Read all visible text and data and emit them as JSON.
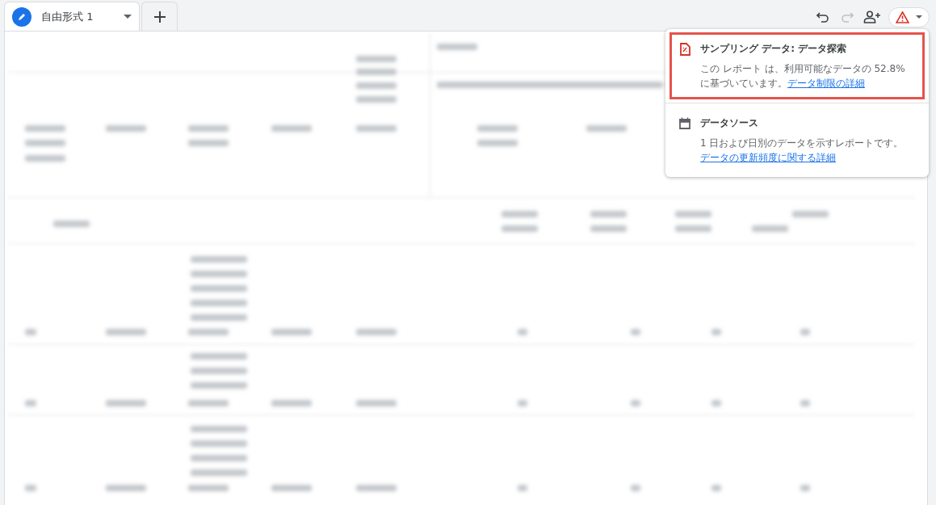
{
  "tabs": [
    {
      "label": "自由形式 1",
      "selected": true
    }
  ],
  "popup": {
    "items": [
      {
        "kind": "warning",
        "title": "サンプリング データ: データ探索",
        "text": "この レポート は、利用可能なデータの 52.8% に基づいています。",
        "link": "データ制限の詳細",
        "highlighted": true
      },
      {
        "kind": "calendar",
        "title": "データソース",
        "text": "1 日および日別のデータを示すレポートです。",
        "link": "データの更新頻度に関する詳細",
        "highlighted": false
      }
    ]
  }
}
